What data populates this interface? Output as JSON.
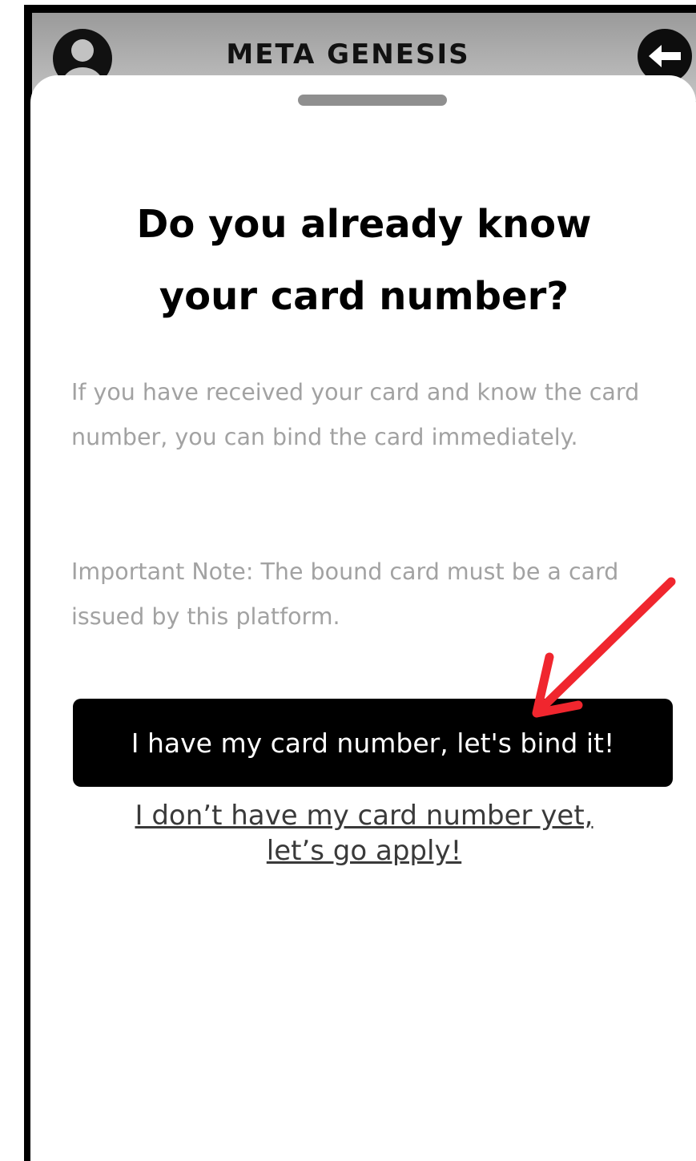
{
  "header": {
    "title": "META GENESIS",
    "avatar_icon": "user-avatar-icon",
    "back_icon": "arrow-left-icon"
  },
  "dialog": {
    "headline_line1": "Do you already know",
    "headline_line2": "your card number?",
    "description": "If you have received your card and know the card number, you can bind the card immediately.",
    "note": "Important Note: The bound card must be a card issued by this platform.",
    "primary_button_label": "I have my card number, let's bind it!",
    "secondary_link_line1": "I don’t have my card number yet,",
    "secondary_link_line2": "let’s go apply!"
  },
  "annotation": {
    "arrow_icon": "red-pointer-arrow-icon",
    "arrow_color": "#f0262e"
  },
  "colors": {
    "header_bg": "#a8a8a8",
    "primary_button_bg": "#000000",
    "body_text": "#a2a2a2"
  }
}
